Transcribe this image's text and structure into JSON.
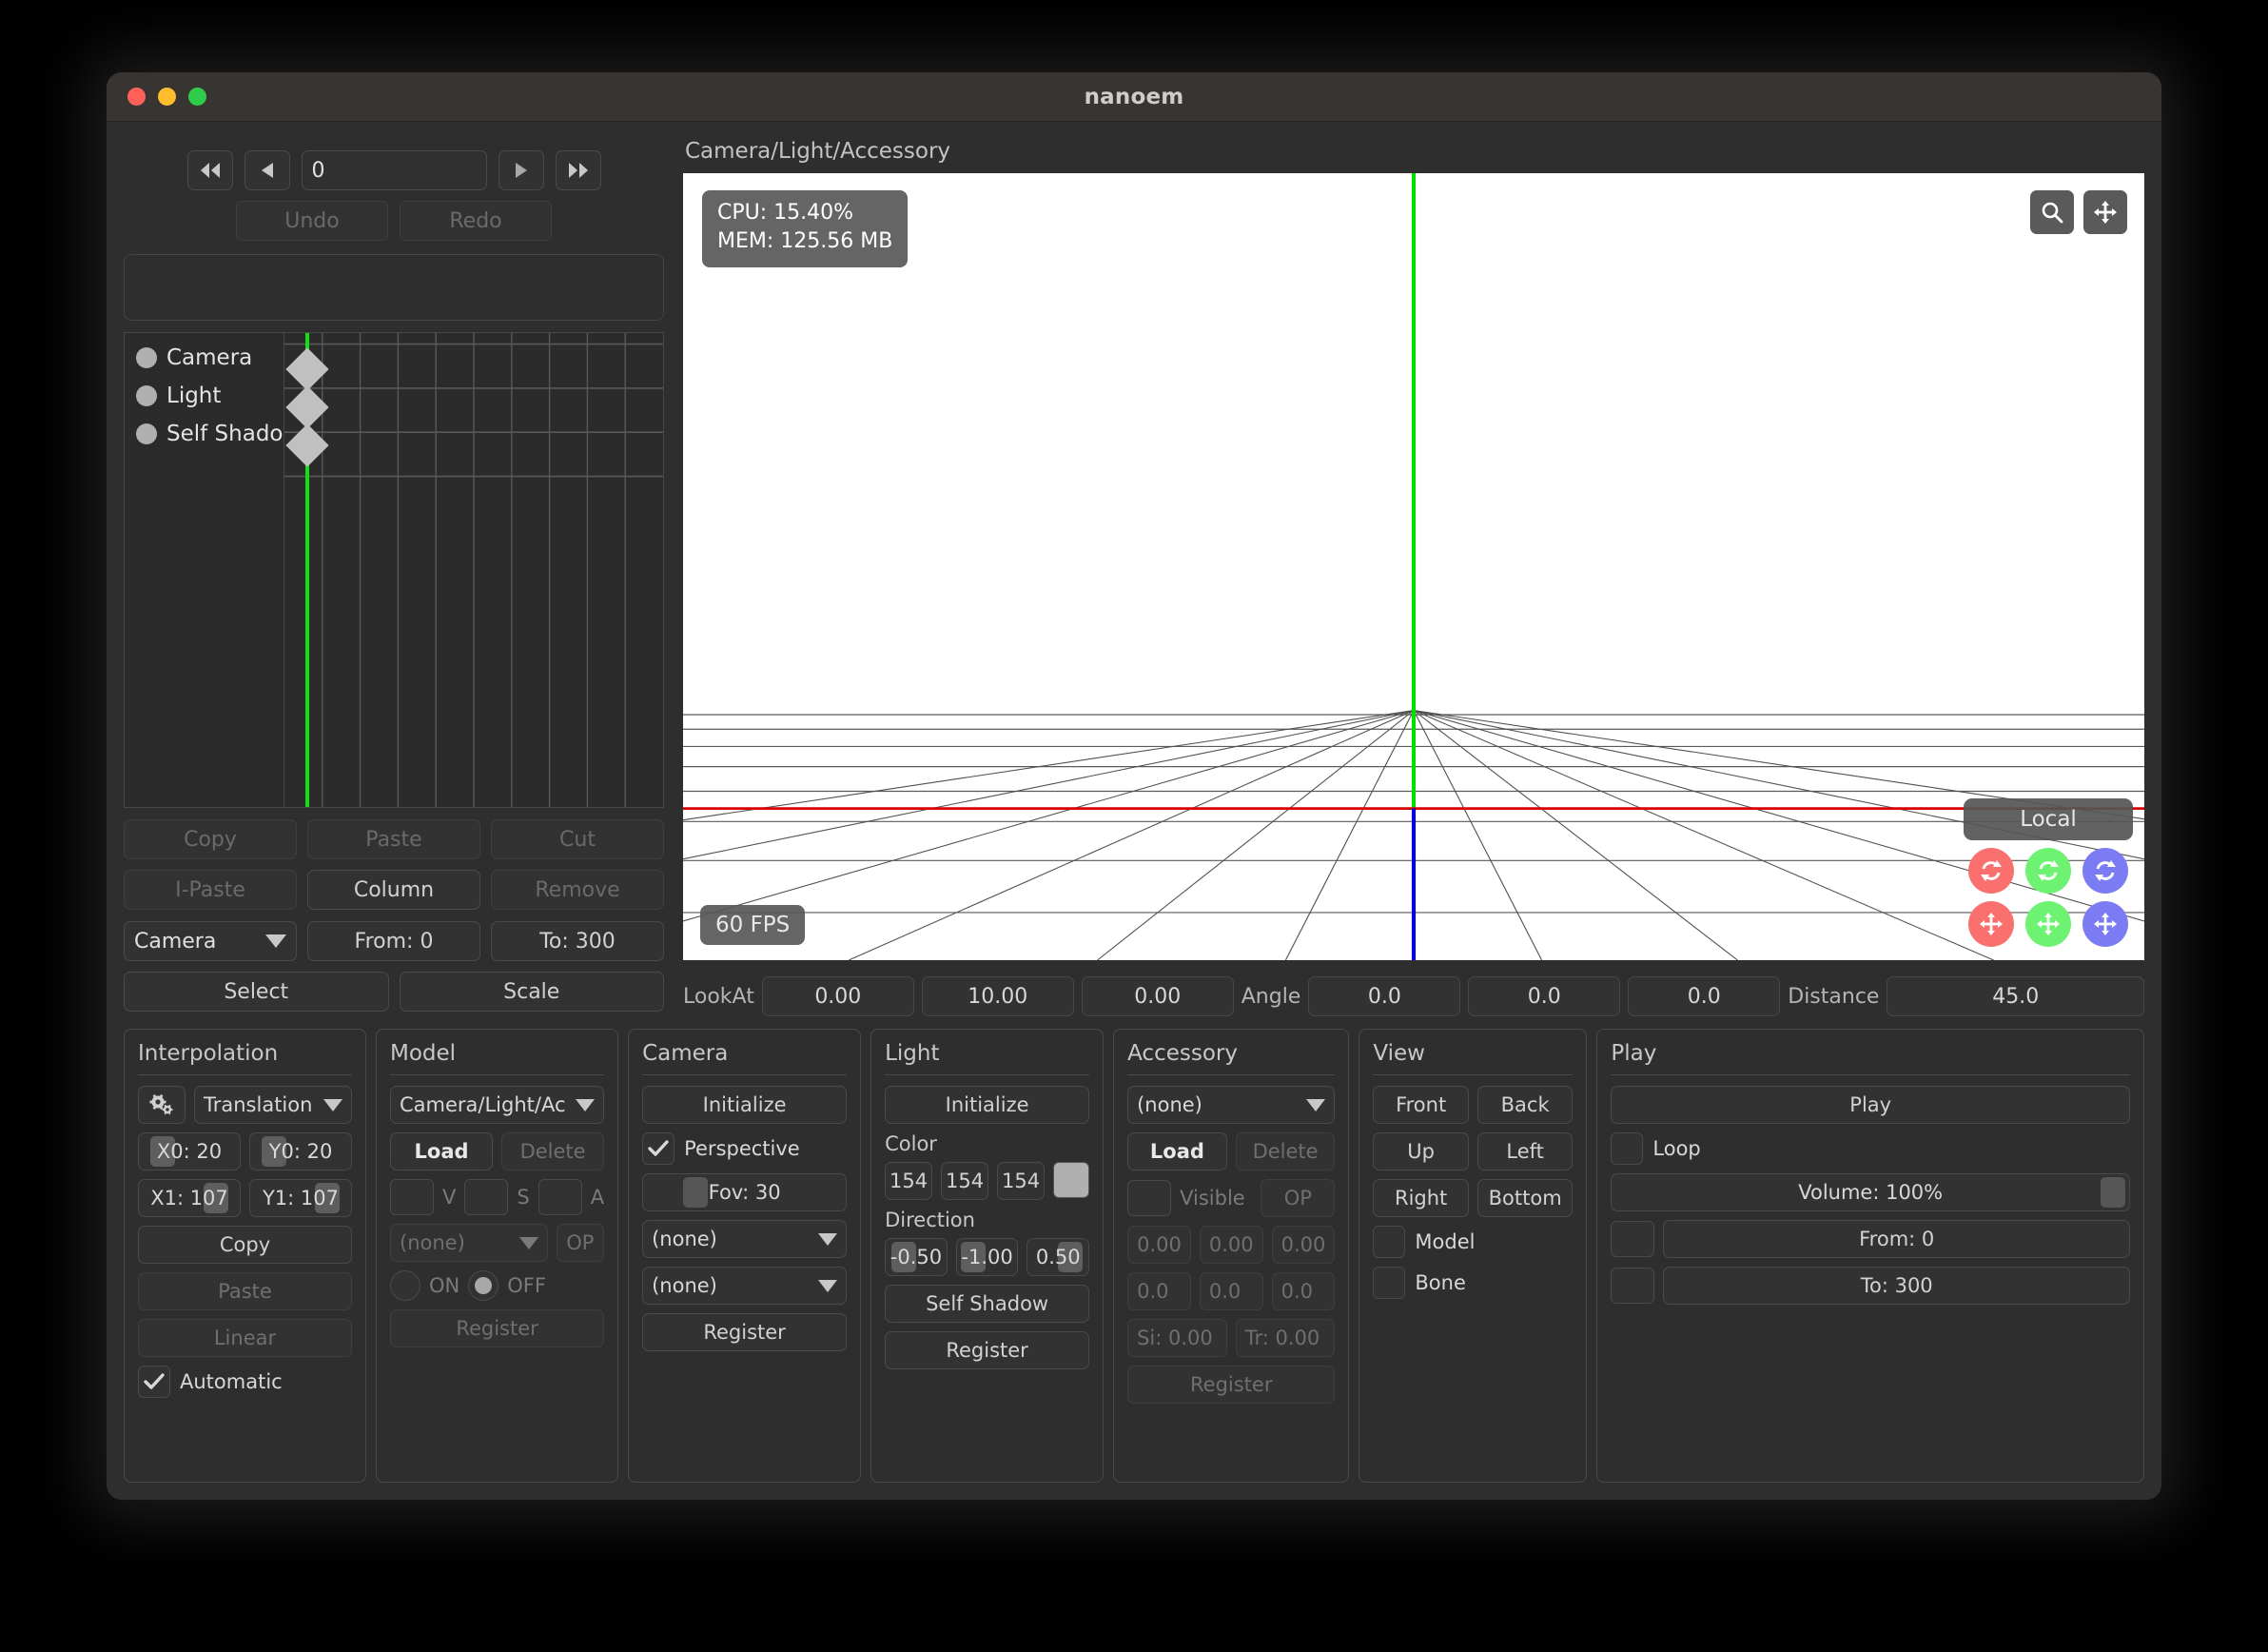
{
  "window": {
    "title": "nanoem",
    "traffic_lights": [
      "close",
      "minimize",
      "zoom"
    ]
  },
  "timeline": {
    "transport": {
      "first_label": "⏮",
      "prev_label": "◀",
      "frame_value": "0",
      "play_label": "▶",
      "last_label": "⏭"
    },
    "undo_label": "Undo",
    "redo_label": "Redo",
    "tracks": [
      {
        "name": "Camera"
      },
      {
        "name": "Light"
      },
      {
        "name": "Self Shadow"
      }
    ],
    "edit_buttons": [
      "Copy",
      "Paste",
      "Cut",
      "I-Paste",
      "Column",
      "Remove"
    ],
    "track_select": "Camera",
    "from_label": "From: 0",
    "to_label": "To: 300",
    "select_label": "Select",
    "scale_label": "Scale"
  },
  "viewport": {
    "header": "Camera/Light/Accessory",
    "stats": {
      "cpu": "CPU: 15.40%",
      "mem": "MEM: 125.56 MB"
    },
    "tools": [
      "search-icon",
      "move-icon"
    ],
    "fps": "60 FPS",
    "coordinate_mode": "Local",
    "gizmo_rotate": [
      "rotate-x",
      "rotate-y",
      "rotate-z"
    ],
    "gizmo_translate": [
      "translate-x",
      "translate-y",
      "translate-z"
    ],
    "colors": {
      "axis_x": "#ff0000",
      "axis_y": "#00e000",
      "axis_z": "#0000ff",
      "gizmo_red": "#f9706e",
      "gizmo_green": "#6ef272",
      "gizmo_blue": "#7b7bf4"
    }
  },
  "camera_bar": {
    "lookat_label": "LookAt",
    "lookat": [
      "0.00",
      "10.00",
      "0.00"
    ],
    "angle_label": "Angle",
    "angle": [
      "0.0",
      "0.0",
      "0.0"
    ],
    "distance_label": "Distance",
    "distance": "45.0"
  },
  "panels": {
    "interpolation": {
      "title": "Interpolation",
      "gear_icon": "gears-icon",
      "type": "Translation",
      "x0": "X0: 20",
      "y0": "Y0: 20",
      "x1": "X1: 107",
      "y1": "Y1: 107",
      "copy": "Copy",
      "paste": "Paste",
      "linear": "Linear",
      "automatic": "Automatic"
    },
    "model": {
      "title": "Model",
      "selected": "Camera/Light/Ac",
      "load": "Load",
      "delete": "Delete",
      "v": "V",
      "s": "S",
      "a": "A",
      "morph": "(none)",
      "op": "OP",
      "on": "ON",
      "off": "OFF",
      "register": "Register"
    },
    "camera": {
      "title": "Camera",
      "initialize": "Initialize",
      "perspective": "Perspective",
      "fov": "Fov: 30",
      "preset1": "(none)",
      "preset2": "(none)",
      "register": "Register"
    },
    "light": {
      "title": "Light",
      "initialize": "Initialize",
      "color_label": "Color",
      "color": [
        "154",
        "154",
        "154"
      ],
      "color_hex": "#9a9a9a",
      "direction_label": "Direction",
      "direction": [
        "-0.50",
        "-1.00",
        "0.50"
      ],
      "self_shadow": "Self Shadow",
      "register": "Register"
    },
    "accessory": {
      "title": "Accessory",
      "selected": "(none)",
      "load": "Load",
      "delete": "Delete",
      "visible": "Visible",
      "op": "OP",
      "translation": [
        "0.00",
        "0.00",
        "0.00"
      ],
      "rotation": [
        "0.0",
        "0.0",
        "0.0"
      ],
      "scale": "Si: 0.00",
      "transparency": "Tr: 0.00",
      "register": "Register"
    },
    "view": {
      "title": "View",
      "front": "Front",
      "back": "Back",
      "up": "Up",
      "left": "Left",
      "right": "Right",
      "bottom": "Bottom",
      "model": "Model",
      "bone": "Bone"
    },
    "play": {
      "title": "Play",
      "play": "Play",
      "loop": "Loop",
      "volume": "Volume: 100%",
      "from": "From: 0",
      "to": "To: 300"
    }
  }
}
